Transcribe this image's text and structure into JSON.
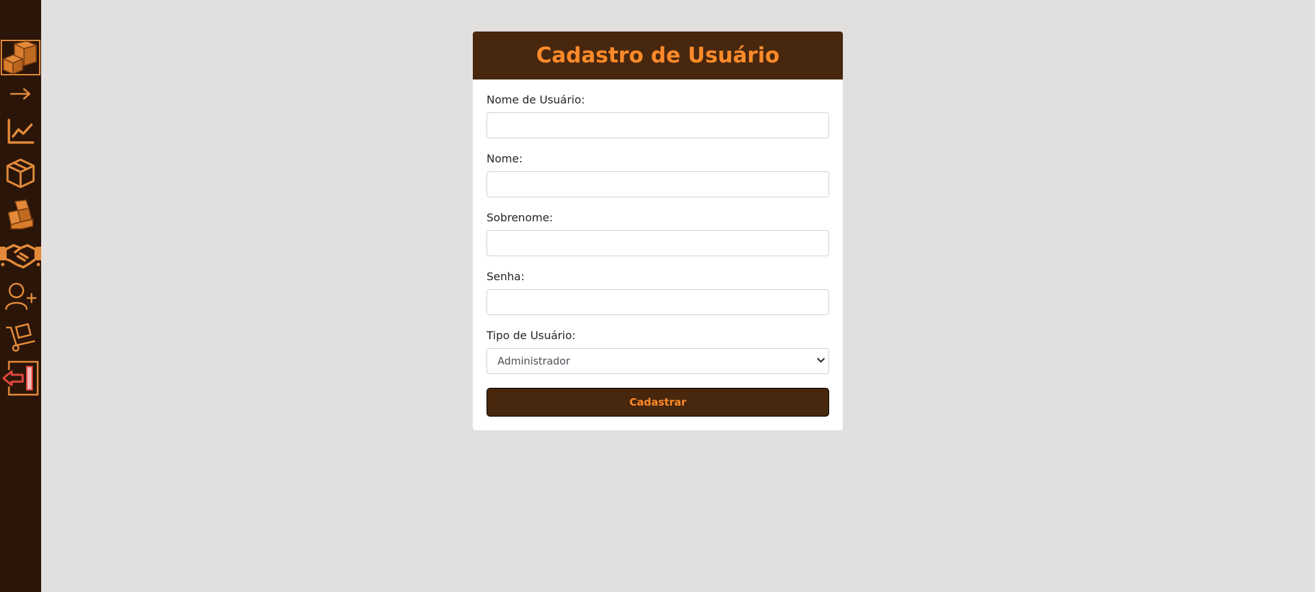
{
  "sidebar": {
    "items": [
      {
        "name": "logo",
        "icon": "boxes-icon"
      },
      {
        "name": "arrow",
        "icon": "arrow-right-icon"
      },
      {
        "name": "dashboard",
        "icon": "line-chart-icon"
      },
      {
        "name": "products",
        "icon": "box-icon"
      },
      {
        "name": "stock",
        "icon": "boxes-stack-icon"
      },
      {
        "name": "partners",
        "icon": "handshake-icon"
      },
      {
        "name": "add-user",
        "icon": "user-plus-icon"
      },
      {
        "name": "delivery",
        "icon": "dolly-icon"
      },
      {
        "name": "logout",
        "icon": "logout-icon"
      }
    ]
  },
  "form": {
    "title": "Cadastro de Usuário",
    "fields": {
      "username": {
        "label": "Nome de Usuário:",
        "value": ""
      },
      "first_name": {
        "label": "Nome:",
        "value": ""
      },
      "last_name": {
        "label": "Sobrenome:",
        "value": ""
      },
      "password": {
        "label": "Senha:",
        "value": ""
      },
      "user_type": {
        "label": "Tipo de Usuário:",
        "selected": "Administrador"
      }
    },
    "submit_label": "Cadastrar"
  },
  "colors": {
    "sidebar_bg": "#2a1508",
    "header_bg": "#47270d",
    "accent": "#ff8a2a",
    "icon": "#e38a3a",
    "logout_red": "#e4473f",
    "page_bg": "#e2dfdf"
  }
}
